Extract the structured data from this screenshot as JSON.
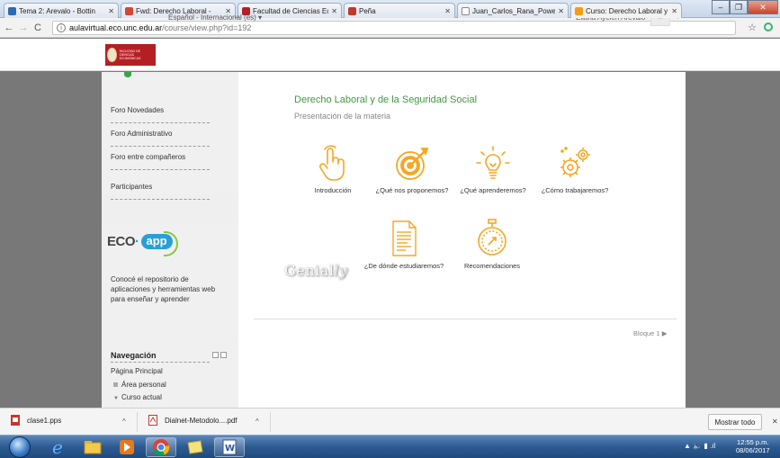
{
  "browser": {
    "tabs": [
      {
        "title": "Tema 2: Arevalo - Bottin",
        "favicon_color": "#2b6cb0"
      },
      {
        "title": "Fwd: Derecho Laboral - ",
        "favicon_color": "#d44638"
      },
      {
        "title": "Facultad de Ciencias Eco",
        "favicon_color": "#b41f24"
      },
      {
        "title": "Peña",
        "favicon_color": "#c0392b"
      },
      {
        "title": "Juan_Carlos_Rana_Power",
        "favicon_color": "#888888"
      },
      {
        "title": "Curso: Derecho Laboral y",
        "favicon_color": "#f39c12"
      }
    ],
    "url_host": "aulavirtual.eco.unc.edu.ar",
    "url_path": "/course/view.php?id=192"
  },
  "header": {
    "logo_text": "FACULTAD DE CIENCIAS ECONÓMICAS",
    "language": "Español - Internacional (es) ▾",
    "user_name": "Eliana Ayelén Arévalo",
    "user_dropdown": "▾"
  },
  "sidebar": {
    "links": [
      "Foro Novedades",
      "Foro Administrativo",
      "Foro entre compañeros",
      "Participantes"
    ],
    "eco_word": "ECO",
    "eco_dot": "·",
    "eco_app": "app",
    "eco_text": "Conocé el repositorio de aplicaciones y herramientas web para enseñar y aprender",
    "nav_title": "Navegación",
    "nav_items": [
      "Página Principal",
      "Área personal",
      "Curso actual"
    ]
  },
  "main": {
    "title": "Derecho Laboral y de la Seguridad Social",
    "subtitle": "Presentación de la materia",
    "tiles": [
      {
        "label": "Introducción",
        "icon": "pointing-hand-icon"
      },
      {
        "label": "¿Qué nos proponemos?",
        "icon": "target-icon"
      },
      {
        "label": "¿Qué aprenderemos?",
        "icon": "lightbulb-icon"
      },
      {
        "label": "¿Cómo trabajaremos?",
        "icon": "gears-icon"
      },
      {
        "label": "¿De dónde estudiaremos?",
        "icon": "document-icon"
      },
      {
        "label": "Recomendaciones",
        "icon": "stopwatch-icon"
      }
    ],
    "genially_word": "Genial",
    "genially_ly": "ly",
    "bloque": "Bloque 1 ▶",
    "accent_color": "#f5a623",
    "title_color": "#3e9a3e"
  },
  "downloads": {
    "items": [
      "clase1.pps",
      "Dialnet-Metodolo....pdf"
    ],
    "show_all": "Mostrar todo",
    "close": "✕"
  },
  "taskbar": {
    "time": "12:55 p.m.",
    "date": "08/06/2017"
  }
}
